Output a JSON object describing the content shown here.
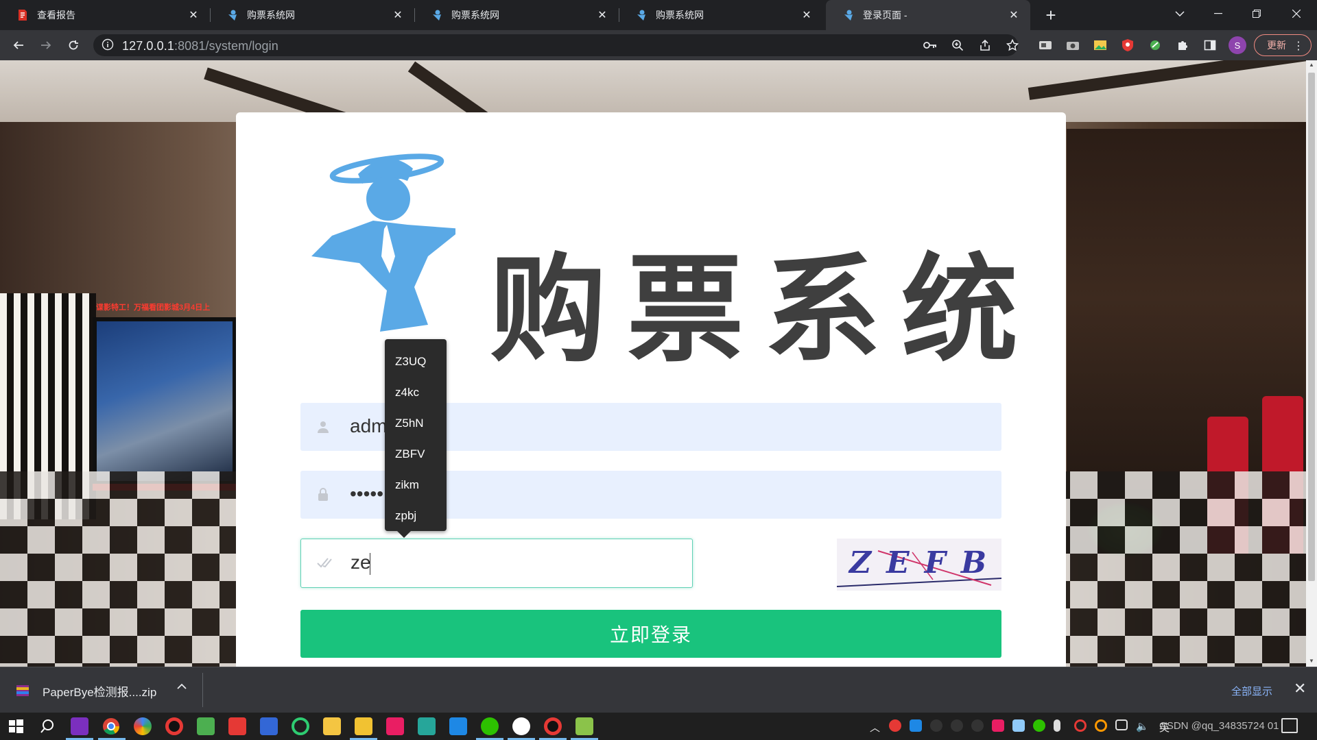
{
  "browser": {
    "tabs": [
      {
        "title": "查看报告",
        "active": false,
        "icon": "red-document-icon"
      },
      {
        "title": "购票系统网",
        "active": false,
        "icon": "mascot-icon"
      },
      {
        "title": "购票系统网",
        "active": false,
        "icon": "mascot-icon"
      },
      {
        "title": "购票系统网",
        "active": false,
        "icon": "mascot-icon"
      },
      {
        "title": "登录页面 -",
        "active": true,
        "icon": "mascot-icon"
      }
    ],
    "url_host": "127.0.0.1",
    "url_rest": ":8081/system/login",
    "update_label": "更新",
    "profile_initial": "S"
  },
  "login": {
    "logo_title": "购票系统",
    "username_value": "adm",
    "password_value": "•••••",
    "captcha_value": "ze",
    "captcha_image_text": "ZEFB",
    "login_button": "立即登录",
    "autocomplete": [
      "Z3UQ",
      "z4kc",
      "Z5hN",
      "ZBFV",
      "zikm",
      "zpbj"
    ]
  },
  "background": {
    "ticker_text": "谍影特工！万福看团影城3月4日上"
  },
  "downloads": {
    "file_name": "PaperBye检测报....zip",
    "show_all": "全部显示"
  },
  "taskbar": {
    "tray_text": "CSDN @qq_34835724 01",
    "ime": "英"
  },
  "colors": {
    "accent_green": "#19c37d",
    "input_bg": "#e8f0fe",
    "focus_border": "#5fd1b4",
    "chrome_dark": "#202124",
    "chrome_toolbar": "#35363a"
  }
}
